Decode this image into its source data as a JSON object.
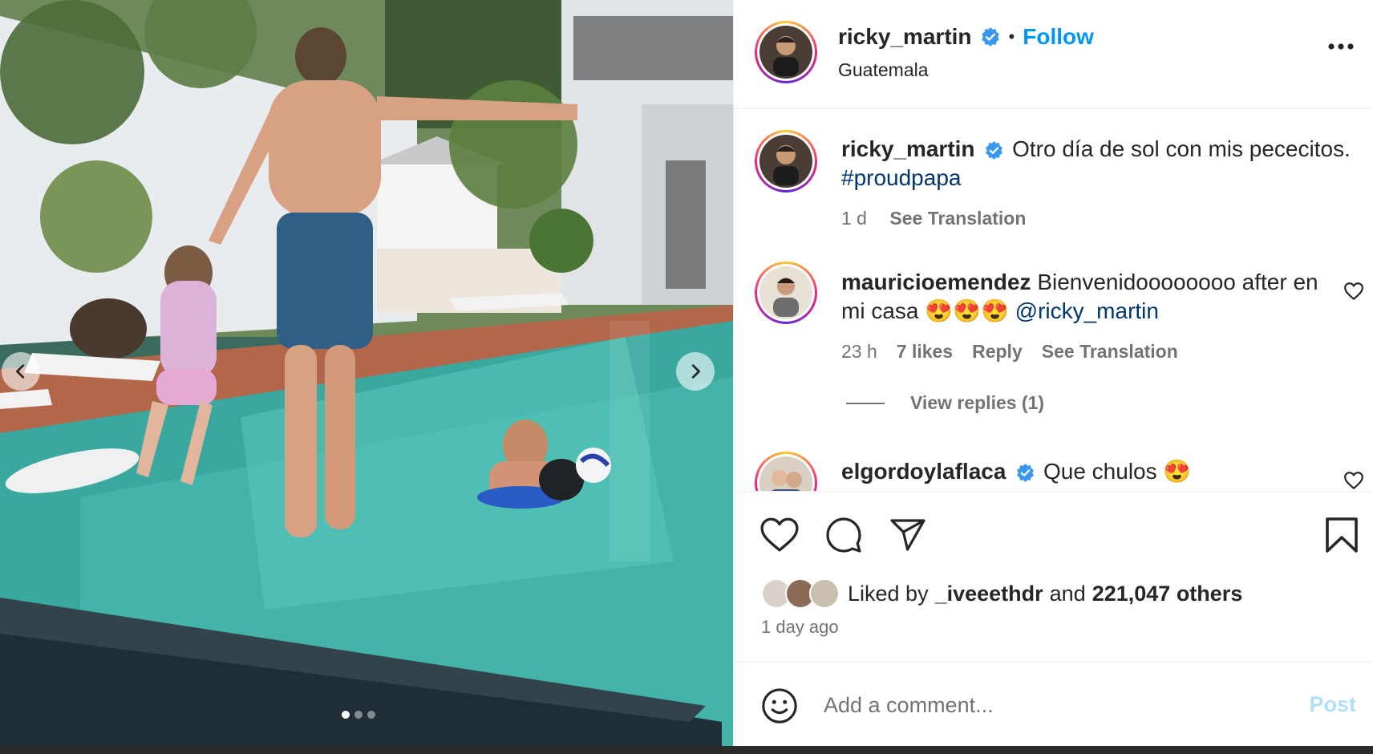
{
  "post": {
    "author": "ricky_martin",
    "follow_label": "Follow",
    "separator": "•",
    "location": "Guatemala",
    "caption_text": "Otro día de sol con mis pececitos.",
    "caption_hashtag": "#proudpapa",
    "caption_age": "1 d",
    "see_translation": "See Translation"
  },
  "comments": [
    {
      "user": "mauricioemendez",
      "text": "Bienvenidoooooooo after en mi casa",
      "emojis": "😍😍😍",
      "mention": "@ricky_martin",
      "age": "23 h",
      "likes": "7 likes",
      "reply": "Reply",
      "see_translation": "See Translation",
      "view_replies": "View replies (1)"
    },
    {
      "user": "elgordoylaflaca",
      "text": "Que chulos",
      "emojis": "😍"
    }
  ],
  "likes": {
    "prefix": "Liked by",
    "user": "_iveeethdr",
    "and": "and",
    "others": "221,047 others",
    "time": "1 day ago"
  },
  "composer": {
    "placeholder": "Add a comment...",
    "post_label": "Post"
  },
  "carousel": {
    "total": 3,
    "active": 1
  },
  "icons": {
    "verified": "verified-badge-icon",
    "more": "more-options-icon",
    "like": "heart-icon",
    "comment": "comment-icon",
    "share": "paper-plane-icon",
    "save": "bookmark-icon",
    "emoji": "emoji-icon",
    "prev": "chevron-left-icon",
    "next": "chevron-right-icon"
  },
  "colors": {
    "accent": "#0095f6",
    "link": "#00376b",
    "muted": "#737373",
    "post_disabled": "#b2dffc"
  }
}
